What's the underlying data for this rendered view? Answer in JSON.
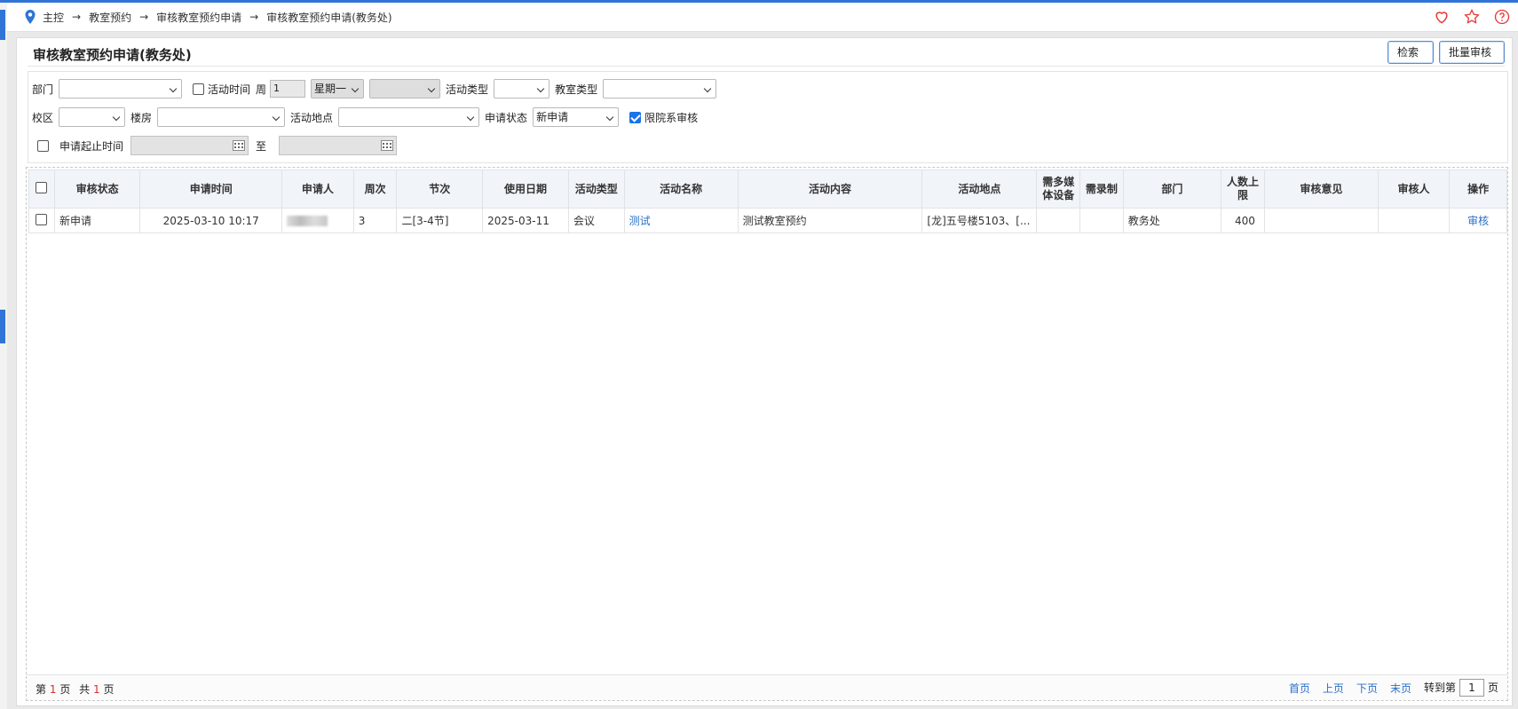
{
  "breadcrumb": [
    "主控",
    "教室预约",
    "审核教室预约申请",
    "审核教室预约申请(教务处)"
  ],
  "breadcrumb_separator": "→",
  "page_title": "审核教室预约申请(教务处)",
  "buttons": {
    "search": "检索",
    "batch_review": "批量审核"
  },
  "filters": {
    "department_label": "部门",
    "activity_time_label": "活动时间",
    "week_label": "周",
    "week_value": "1",
    "weekday_value": "星期一",
    "activity_type_label": "活动类型",
    "room_type_label": "教室类型",
    "campus_label": "校区",
    "building_label": "楼房",
    "location_label": "活动地点",
    "status_label": "申请状态",
    "status_value": "新申请",
    "limit_dept_label": "限院系审核",
    "date_range_label": "申请起止时间",
    "to_label": "至"
  },
  "table": {
    "headers": [
      "审核状态",
      "申请时间",
      "申请人",
      "周次",
      "节次",
      "使用日期",
      "活动类型",
      "活动名称",
      "活动内容",
      "活动地点",
      "需多媒体设备",
      "需录制",
      "部门",
      "人数上限",
      "审核意见",
      "审核人",
      "操作"
    ],
    "rows": [
      {
        "status": "新申请",
        "apply_time": "2025-03-10 10:17",
        "week": "3",
        "period": "二[3-4节]",
        "use_date": "2025-03-11",
        "type": "会议",
        "name": "测试",
        "content": "测试教室预约",
        "location": "[龙]五号楼5103、[...",
        "multimedia": "",
        "record": "",
        "dept": "教务处",
        "capacity": "400",
        "opinion": "",
        "reviewer": "",
        "action": "审核"
      }
    ]
  },
  "pager": {
    "prefix": "第",
    "page": "1",
    "page_suffix": "页",
    "total_prefix": "共",
    "total": "1",
    "total_suffix": "页",
    "first": "首页",
    "prev": "上页",
    "next": "下页",
    "last": "末页",
    "goto_prefix": "转到第",
    "goto_value": "1",
    "goto_suffix": "页"
  },
  "colors": {
    "accent": "#2f74d6",
    "link": "#2a6fc9",
    "red": "#d32f2f",
    "heart": "#e53935"
  },
  "icons": [
    "location-pin-icon",
    "heart-icon",
    "star-icon",
    "help-icon",
    "calendar-icon"
  ]
}
